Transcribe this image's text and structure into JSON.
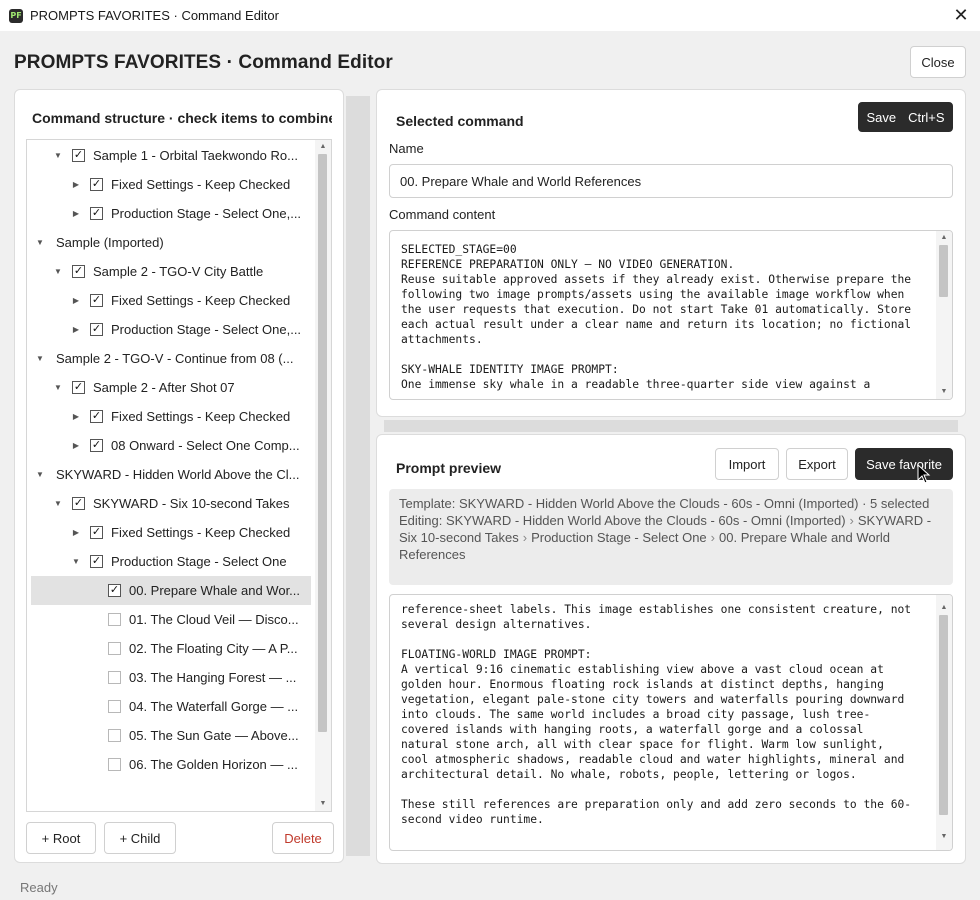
{
  "window": {
    "title": "PROMPTS FAVORITES · Command Editor",
    "icon_text": "PF"
  },
  "header": {
    "title": "PROMPTS FAVORITES · Command Editor",
    "close_label": "Close"
  },
  "left": {
    "heading": "Command structure · check items to combine",
    "tree": [
      {
        "label": "Sample 1 - Orbital Taekwondo Ro...",
        "level": 1,
        "expanded": true,
        "checkbox": true,
        "checked": true
      },
      {
        "label": "Fixed Settings - Keep Checked",
        "level": 2,
        "expanded": false,
        "checkbox": true,
        "checked": true
      },
      {
        "label": "Production Stage - Select One,...",
        "level": 2,
        "expanded": false,
        "checkbox": true,
        "checked": true
      },
      {
        "label": "Sample (Imported)",
        "level": 0,
        "expanded": true,
        "checkbox": false
      },
      {
        "label": "Sample 2 - TGO-V City Battle",
        "level": 1,
        "expanded": true,
        "checkbox": true,
        "checked": true
      },
      {
        "label": "Fixed Settings - Keep Checked",
        "level": 2,
        "expanded": false,
        "checkbox": true,
        "checked": true
      },
      {
        "label": "Production Stage - Select One,...",
        "level": 2,
        "expanded": false,
        "checkbox": true,
        "checked": true
      },
      {
        "label": "Sample 2 - TGO-V - Continue from 08 (...",
        "level": 0,
        "expanded": true,
        "checkbox": false
      },
      {
        "label": "Sample 2 - After Shot 07",
        "level": 1,
        "expanded": true,
        "checkbox": true,
        "checked": true
      },
      {
        "label": "Fixed Settings - Keep Checked",
        "level": 2,
        "expanded": false,
        "checkbox": true,
        "checked": true
      },
      {
        "label": "08 Onward - Select One Comp...",
        "level": 2,
        "expanded": false,
        "checkbox": true,
        "checked": true
      },
      {
        "label": "SKYWARD - Hidden World Above the Cl...",
        "level": 0,
        "expanded": true,
        "checkbox": false
      },
      {
        "label": "SKYWARD - Six 10-second Takes",
        "level": 1,
        "expanded": true,
        "checkbox": true,
        "checked": true
      },
      {
        "label": "Fixed Settings - Keep Checked",
        "level": 2,
        "expanded": false,
        "checkbox": true,
        "checked": true
      },
      {
        "label": "Production Stage - Select One",
        "level": 2,
        "expanded": true,
        "checkbox": true,
        "checked": true
      },
      {
        "label": "00. Prepare Whale and Wor...",
        "level": 3,
        "leaf": true,
        "checkbox": true,
        "checked": true,
        "selected": true
      },
      {
        "label": "01. The Cloud Veil — Disco...",
        "level": 3,
        "leaf": true,
        "checkbox": true,
        "checked": false
      },
      {
        "label": "02. The Floating City — A P...",
        "level": 3,
        "leaf": true,
        "checkbox": true,
        "checked": false
      },
      {
        "label": "03. The Hanging Forest — ...",
        "level": 3,
        "leaf": true,
        "checkbox": true,
        "checked": false
      },
      {
        "label": "04. The Waterfall Gorge — ...",
        "level": 3,
        "leaf": true,
        "checkbox": true,
        "checked": false
      },
      {
        "label": "05. The Sun Gate — Above...",
        "level": 3,
        "leaf": true,
        "checkbox": true,
        "checked": false
      },
      {
        "label": "06. The Golden Horizon — ...",
        "level": 3,
        "leaf": true,
        "checkbox": true,
        "checked": false
      }
    ],
    "buttons": {
      "root": "+ Root",
      "child": "+ Child",
      "delete": "Delete"
    }
  },
  "selected": {
    "title": "Selected command",
    "save_label": "Save",
    "save_shortcut": "Ctrl+S",
    "name_label": "Name",
    "name_value": "00. Prepare Whale and World References",
    "content_label": "Command content",
    "content_lines": [
      "SELECTED_STAGE=00",
      "REFERENCE PREPARATION ONLY — NO VIDEO GENERATION.",
      "Reuse suitable approved assets if they already exist. Otherwise prepare the",
      "following two image prompts/assets using the available image workflow when",
      "the user requests that execution. Do not start Take 01 automatically. Store",
      "each actual result under a clear name and return its location; no fictional",
      "attachments.",
      "",
      "SKY-WHALE IDENTITY IMAGE PROMPT:",
      "One immense sky whale in a readable three-quarter side view against a"
    ]
  },
  "preview": {
    "title": "Prompt preview",
    "import_label": "Import",
    "export_label": "Export",
    "save_favorite_label": "Save favorite",
    "template_line": "Template: SKYWARD - Hidden World Above the Clouds - 60s - Omni (Imported) · 5 selected",
    "editing_prefix": "Editing:",
    "path": [
      "SKYWARD - Hidden World Above the Clouds - 60s - Omni (Imported)",
      "SKYWARD - Six 10-second Takes",
      "Production Stage - Select One",
      "00. Prepare Whale and World References"
    ],
    "content_lines": [
      "reference-sheet labels. This image establishes one consistent creature, not",
      "several design alternatives.",
      "",
      "FLOATING-WORLD IMAGE PROMPT:",
      "A vertical 9:16 cinematic establishing view above a vast cloud ocean at",
      "golden hour. Enormous floating rock islands at distinct depths, hanging",
      "vegetation, elegant pale-stone city towers and waterfalls pouring downward",
      "into clouds. The same world includes a broad city passage, lush tree-",
      "covered islands with hanging roots, a waterfall gorge and a colossal",
      "natural stone arch, all with clear space for flight. Warm low sunlight,",
      "cool atmospheric shadows, readable cloud and water highlights, mineral and",
      "architectural detail. No whale, robots, people, lettering or logos.",
      "",
      "These still references are preparation only and add zero seconds to the 60-",
      "second video runtime."
    ]
  },
  "status": "Ready",
  "colors": {
    "dark_button": "#2b2b2b",
    "delete_text": "#c0392b",
    "selected_row": "#e2e2e2",
    "background": "#f0f0f0"
  }
}
